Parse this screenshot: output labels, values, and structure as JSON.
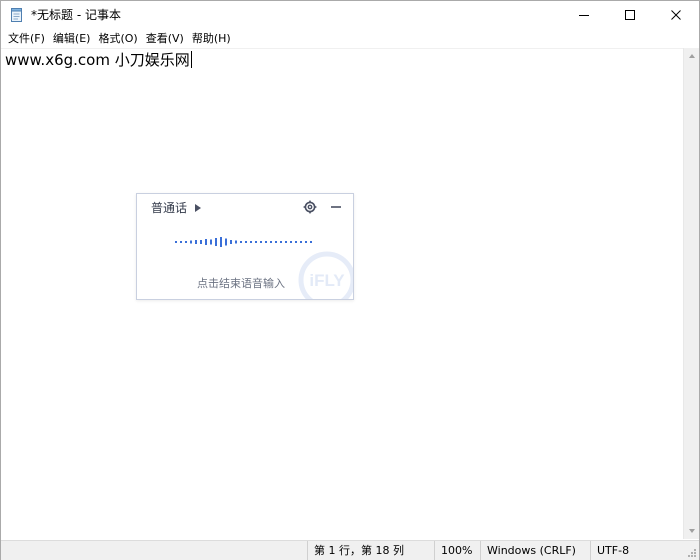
{
  "window": {
    "title": "*无标题 - 记事本",
    "app_icon": "notepad-icon",
    "controls": [
      "minimize-icon",
      "maximize-icon",
      "close-icon"
    ]
  },
  "menu": {
    "items": [
      {
        "label": "文件(F)"
      },
      {
        "label": "编辑(E)"
      },
      {
        "label": "格式(O)"
      },
      {
        "label": "查看(V)"
      },
      {
        "label": "帮助(H)"
      }
    ]
  },
  "editor": {
    "content": "www.x6g.com 小刀娱乐网"
  },
  "voice_input": {
    "language": "普通话",
    "hint": "点击结束语音输入",
    "watermark": "iFLY",
    "accent_color": "#3a6fd8",
    "icons": [
      "play-arrow-icon",
      "settings-gear-icon",
      "minimize-dash-icon",
      "waveform-icon"
    ]
  },
  "status": {
    "position": "第 1 行，第 18 列",
    "zoom": "100%",
    "line_ending": "Windows (CRLF)",
    "encoding": "UTF-8"
  }
}
